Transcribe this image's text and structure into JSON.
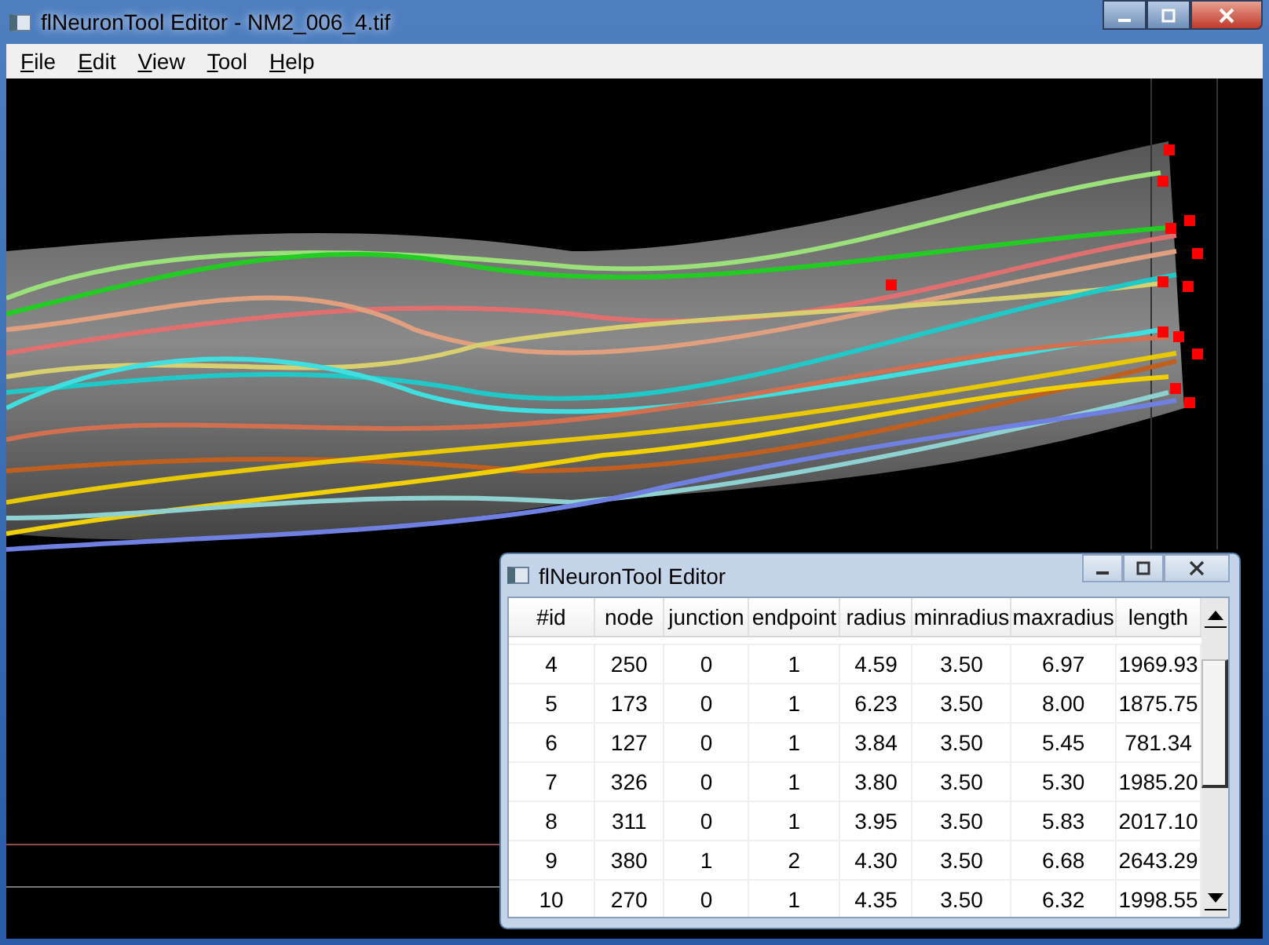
{
  "window": {
    "title": "flNeuronTool Editor - NM2_006_4.tif"
  },
  "menu": [
    {
      "label": "File"
    },
    {
      "label": "Edit"
    },
    {
      "label": "View"
    },
    {
      "label": "Tool"
    },
    {
      "label": "Help"
    }
  ],
  "editor": {
    "title": "flNeuronTool Editor",
    "table": {
      "columns": [
        "#id",
        "node",
        "junction",
        "endpoint",
        "radius",
        "minradius",
        "maxradius",
        "length"
      ],
      "rows": [
        [
          "4",
          "250",
          "0",
          "1",
          "4.59",
          "3.50",
          "6.97",
          "1969.93"
        ],
        [
          "5",
          "173",
          "0",
          "1",
          "6.23",
          "3.50",
          "8.00",
          "1875.75"
        ],
        [
          "6",
          "127",
          "0",
          "1",
          "3.84",
          "3.50",
          "5.45",
          "781.34"
        ],
        [
          "7",
          "326",
          "0",
          "1",
          "3.80",
          "3.50",
          "5.30",
          "1985.20"
        ],
        [
          "8",
          "311",
          "0",
          "1",
          "3.95",
          "3.50",
          "5.83",
          "2017.10"
        ],
        [
          "9",
          "380",
          "1",
          "2",
          "4.30",
          "3.50",
          "6.68",
          "2643.29"
        ],
        [
          "10",
          "270",
          "0",
          "1",
          "4.35",
          "3.50",
          "6.32",
          "1998.55"
        ]
      ]
    }
  }
}
